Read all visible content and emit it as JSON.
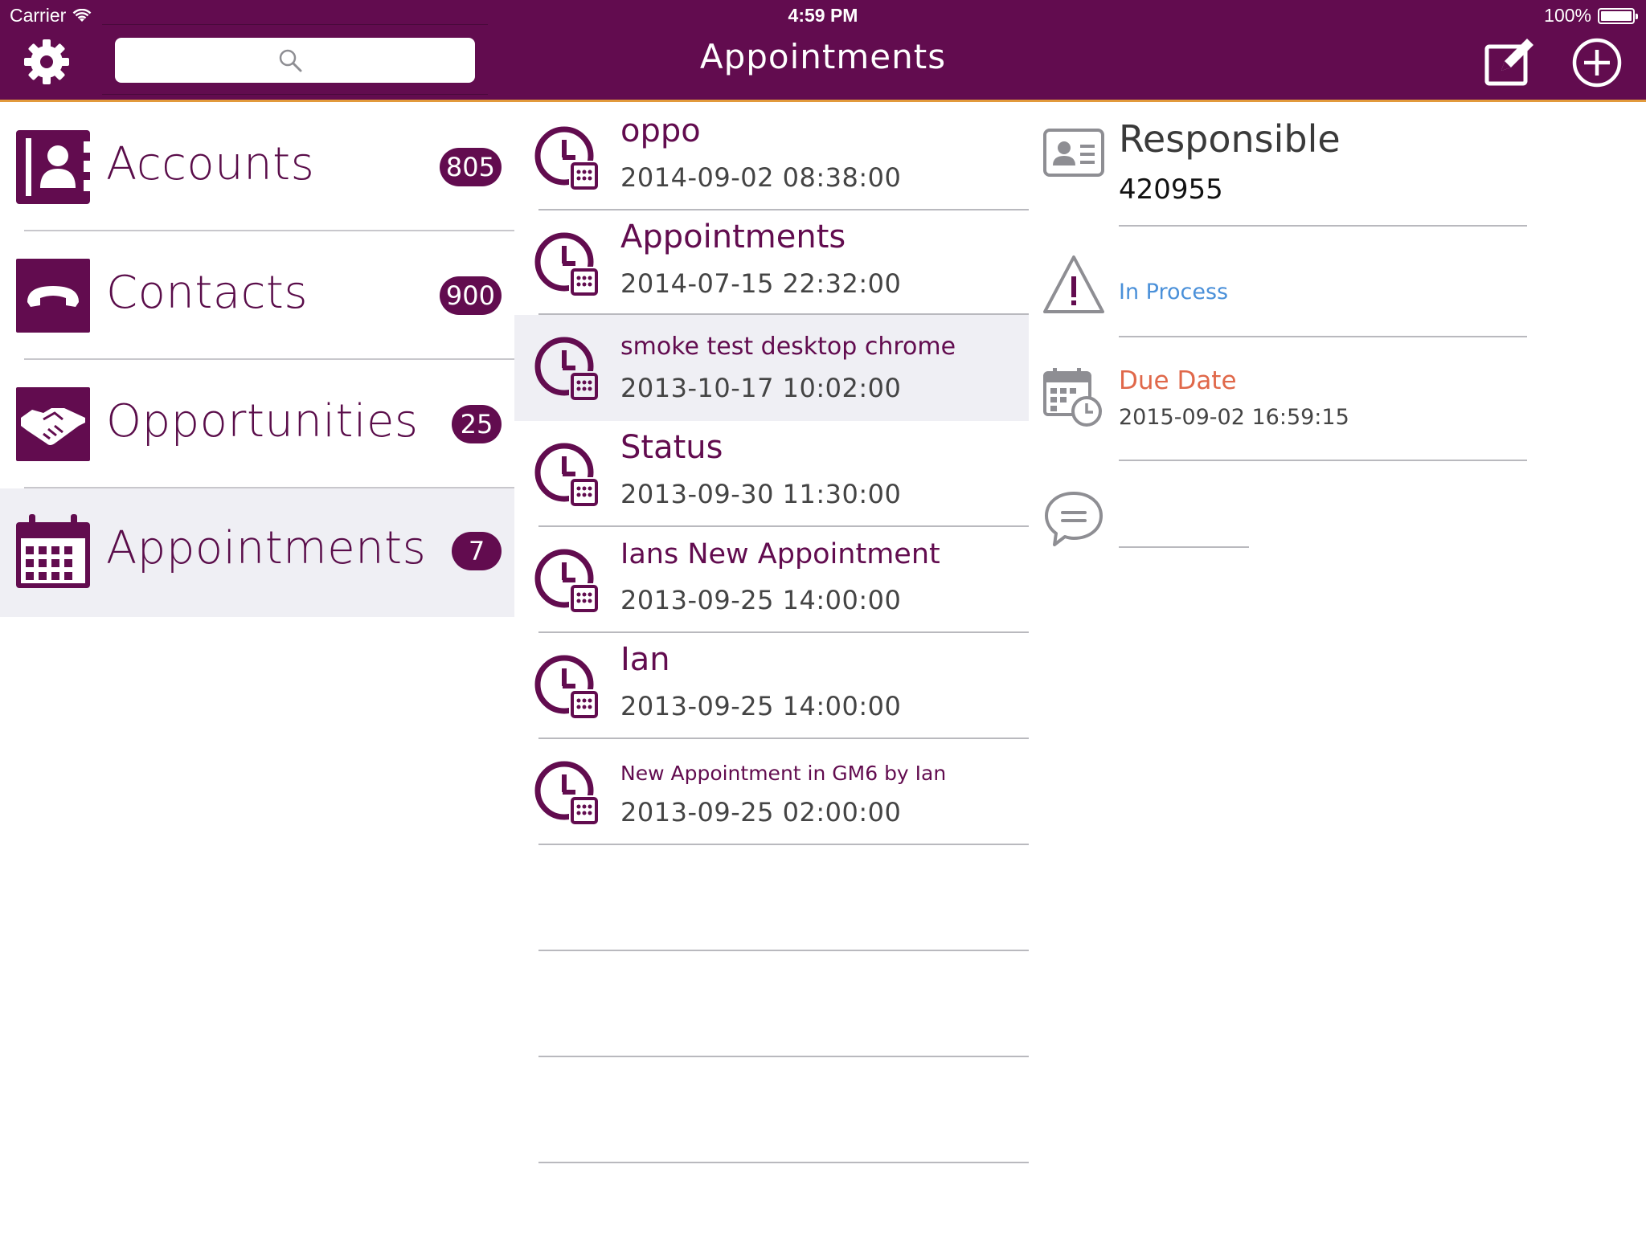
{
  "status_bar": {
    "carrier": "Carrier",
    "time": "4:59 PM",
    "battery": "100%",
    "battery_level": 1.0
  },
  "header": {
    "title": "Appointments",
    "search": {
      "placeholder": "",
      "value": ""
    },
    "icons": {
      "settings": "gear-icon",
      "search": "search-icon",
      "edit": "edit-icon",
      "add": "add-circle-icon"
    }
  },
  "colors": {
    "brand": "#620c4f",
    "header_accent": "#e29a3c",
    "selected_bg": "#efeff4",
    "status_blue": "#4a90d9",
    "due_orange": "#e0684a"
  },
  "sidebar": {
    "items": [
      {
        "label": "Accounts",
        "badge": "805",
        "icon": "accounts-icon",
        "selected": false
      },
      {
        "label": "Contacts",
        "badge": "900",
        "icon": "phone-icon",
        "selected": false
      },
      {
        "label": "Opportunities",
        "badge": "25",
        "icon": "handshake-icon",
        "selected": false
      },
      {
        "label": "Appointments",
        "badge": "7",
        "icon": "calendar-icon",
        "selected": true
      }
    ]
  },
  "list": {
    "items": [
      {
        "title": "oppo",
        "date": "2014-09-02 08:38:00",
        "selected": false
      },
      {
        "title": "Appointments",
        "date": "2014-07-15 22:32:00",
        "selected": false
      },
      {
        "title": "smoke test desktop chrome",
        "date": "2013-10-17 10:02:00",
        "selected": true
      },
      {
        "title": "Status",
        "date": "2013-09-30 11:30:00",
        "selected": false
      },
      {
        "title": "Ians New Appointment",
        "date": "2013-09-25 14:00:00",
        "selected": false
      },
      {
        "title": "Ian",
        "date": "2013-09-25 14:00:00",
        "selected": false
      },
      {
        "title": "New Appointment in GM6 by Ian",
        "date": "2013-09-25 02:00:00",
        "selected": false
      }
    ]
  },
  "detail": {
    "responsible_label": "Responsible",
    "responsible_value": "420955",
    "status": "In Process",
    "due_date_label": "Due Date",
    "due_date_value": "2015-09-02 16:59:15",
    "note": ""
  }
}
